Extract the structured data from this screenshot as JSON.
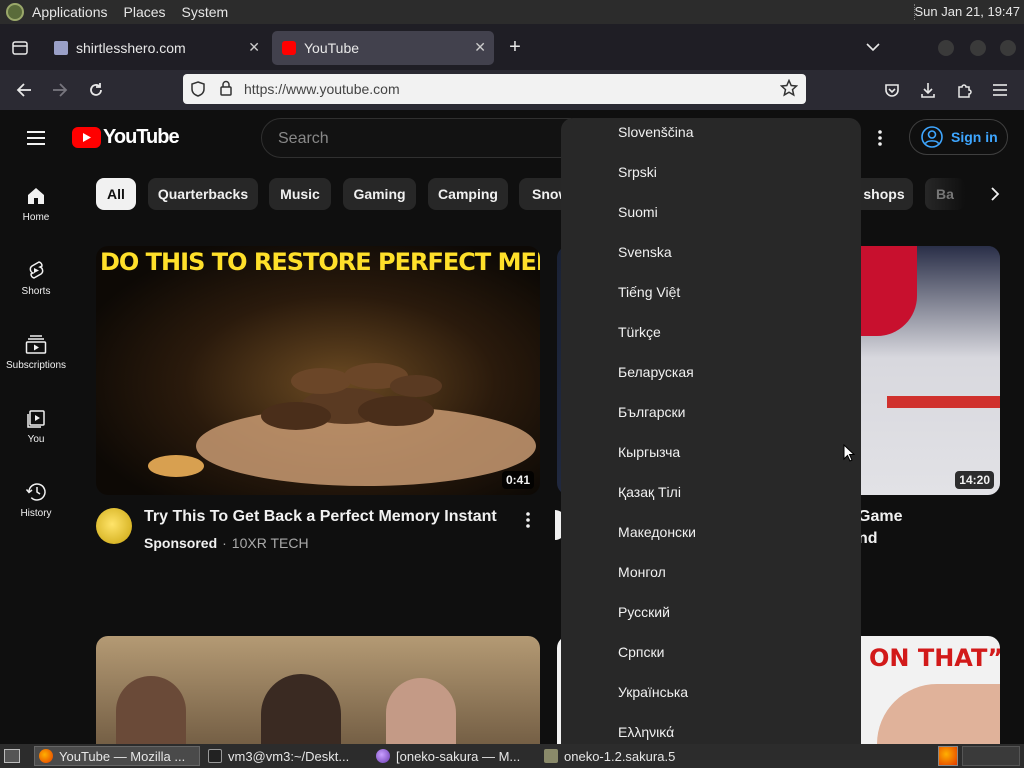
{
  "gnome": {
    "menus": [
      "Applications",
      "Places",
      "System"
    ],
    "clock": "Sun Jan 21, 19:47"
  },
  "browser": {
    "tabs": [
      {
        "title": "shirtlesshero.com"
      },
      {
        "title": "YouTube"
      }
    ],
    "url": "https://www.youtube.com"
  },
  "youtube": {
    "logo_text": "YouTube",
    "search_placeholder": "Search",
    "sign_in": "Sign in",
    "chips": [
      "All",
      "Quarterbacks",
      "Music",
      "Gaming",
      "Camping",
      "Snow",
      "shops",
      "Ba"
    ],
    "nav": [
      {
        "label": "Home",
        "icon": "home-icon"
      },
      {
        "label": "Shorts",
        "icon": "shorts-icon"
      },
      {
        "label": "Subscriptions",
        "icon": "subscriptions-icon"
      },
      {
        "label": "You",
        "icon": "you-icon"
      },
      {
        "label": "History",
        "icon": "history-icon"
      }
    ],
    "videos": [
      {
        "title": "Try This To Get Back a Perfect Memory Instant",
        "sponsored": "Sponsored",
        "channel": "10XR TECH",
        "duration": "0:41",
        "overlay": "DO THIS TO RESTORE PERFECT MEMORY"
      },
      {
        "title_fragment_1": "Game",
        "title_fragment_2": "nd",
        "duration": "14:20"
      },
      {
        "overlay": "ON THAT”"
      }
    ],
    "languages": [
      "Slovenščina",
      "Srpski",
      "Suomi",
      "Svenska",
      "Tiếng Việt",
      "Türkçe",
      "Беларуская",
      "Български",
      "Кыргызча",
      "Қазақ Тілі",
      "Македонски",
      "Монгол",
      "Русский",
      "Српски",
      "Українська",
      "Ελληνικά"
    ]
  },
  "taskbar": {
    "items": [
      "YouTube — Mozilla ...",
      "vm3@vm3:~/Deskt...",
      "[oneko-sakura — M...",
      "oneko-1.2.sakura.5"
    ]
  },
  "colors": {
    "youtube_red": "#ff0000",
    "accent_blue": "#3ea6ff",
    "dropdown_bg": "#282828"
  }
}
